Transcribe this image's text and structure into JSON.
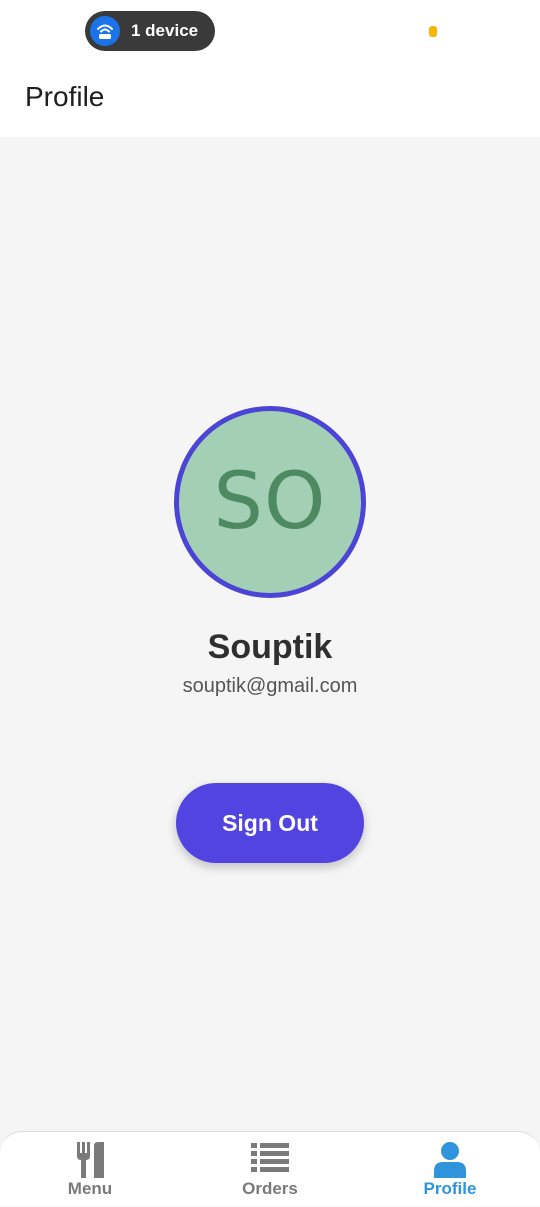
{
  "status_bar": {
    "device_pill_label": "1 device",
    "wifi_icon": "wifi-router-icon",
    "privacy_dot_color": "#f9b500"
  },
  "header": {
    "title": "Profile"
  },
  "profile": {
    "initials": "SO",
    "name": "Souptik",
    "email": "souptik@gmail.com",
    "avatar_bg_color": "#a3d0b4",
    "avatar_ring_color": "#4b44d6"
  },
  "actions": {
    "sign_out_label": "Sign Out",
    "sign_out_color": "#5144e0"
  },
  "bottom_nav": {
    "items": [
      {
        "label": "Menu",
        "icon": "fork-knife-icon",
        "active": false
      },
      {
        "label": "Orders",
        "icon": "list-icon",
        "active": false
      },
      {
        "label": "Profile",
        "icon": "person-icon",
        "active": true
      }
    ],
    "active_color": "#2f94dc",
    "inactive_color": "#7a7a7a"
  }
}
